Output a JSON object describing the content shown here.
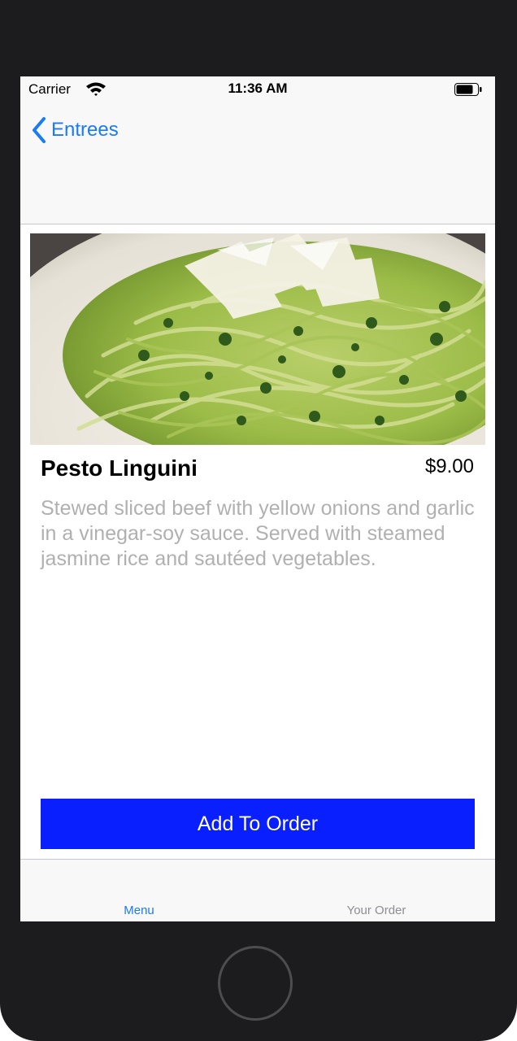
{
  "status_bar": {
    "carrier": "Carrier",
    "time": "11:36 AM",
    "wifi_icon": "wifi-icon",
    "battery_icon": "battery-icon"
  },
  "nav": {
    "back_label": "Entrees",
    "back_icon": "chevron-left-icon"
  },
  "item": {
    "image_subject": "pesto linguini plate",
    "title": "Pesto Linguini",
    "price": "$9.00",
    "description": "Stewed sliced beef with yellow onions and garlic in a vinegar-soy sauce. Served with steamed jasmine rice and sautéed vegetables."
  },
  "actions": {
    "add_to_order": "Add To Order"
  },
  "tabs": [
    {
      "label": "Menu",
      "selected": true
    },
    {
      "label": "Your Order",
      "selected": false
    }
  ],
  "colors": {
    "accent": "#1a7bf2",
    "button": "#0a1ffd",
    "description_text": "#b0b0b0",
    "inactive_tab": "#8e8e93"
  }
}
